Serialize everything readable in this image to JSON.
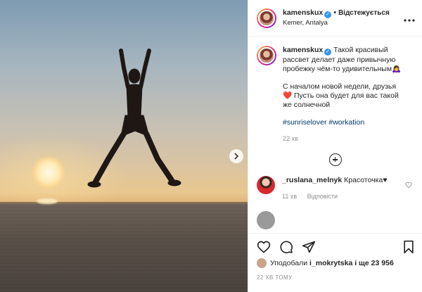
{
  "header": {
    "username": "kamenskux",
    "verified_mark": "✓",
    "dot": "•",
    "follow_status": "Відстежується",
    "location": "Kemer, Antalya",
    "more_icon": "more-dots-icon"
  },
  "caption": {
    "username": "kamenskux",
    "line1": "Такой красивый рассвет делает даже привычную пробежку чём-то удивительным🙇‍♀️",
    "line2": "С началом новой недели, друзья ❤️ Пусть она будет для вас такой же солнечной",
    "hashtag1": "#sunriselover",
    "hashtag2": "#workation",
    "time": "22 хв"
  },
  "comments": [
    {
      "username": "_ruslana_melnyk",
      "text": "Красоточка♥",
      "time": "11 хв",
      "reply": "Відповісти"
    }
  ],
  "likes": {
    "prefix": "Уподобали",
    "user": "i_mokrytska",
    "suffix": "і ще 23 956"
  },
  "timestamp": "22 ХВ ТОМУ",
  "colors": {
    "accent": "#3897f0",
    "link": "#00376b",
    "muted": "#8e8e8e"
  }
}
